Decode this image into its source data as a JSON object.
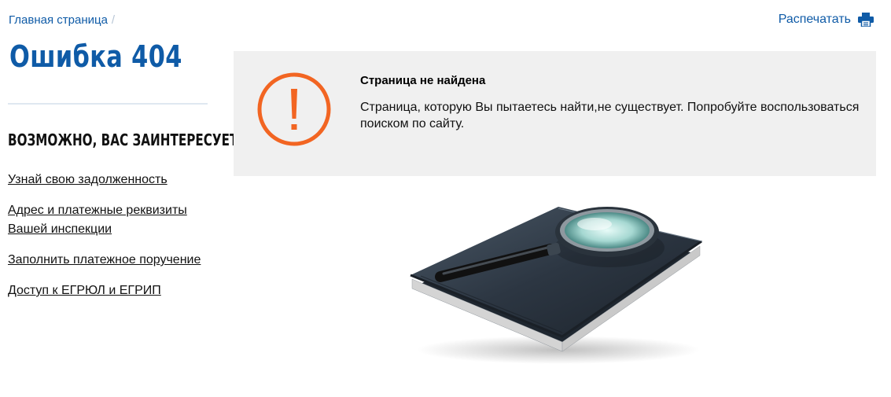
{
  "breadcrumb": {
    "home": "Главная страница",
    "separator": "/"
  },
  "header": {
    "print_label": "Распечатать",
    "print_icon": "printer-icon"
  },
  "page": {
    "title": "Ошибка 404"
  },
  "aside": {
    "heading": "ВОЗМОЖНО, ВАС ЗАИНТЕРЕСУЕТ",
    "links": [
      "Узнай свою задолженность",
      "Адрес и платежные реквизиты Вашей инспекции",
      "Заполнить платежное поручение",
      "Доступ к ЕГРЮЛ и ЕГРИП"
    ]
  },
  "notice": {
    "icon": "warning-icon",
    "title": "Страница не найдена",
    "text": "Страница, которую Вы пытаетесь найти,не существует. Попробуйте воспользоваться поиском по сайту."
  },
  "colors": {
    "link": "#0f5ba7",
    "warning": "#f26522",
    "panel": "#f0f0f0"
  },
  "illustration": {
    "icon": "notebook-magnifier-icon"
  }
}
